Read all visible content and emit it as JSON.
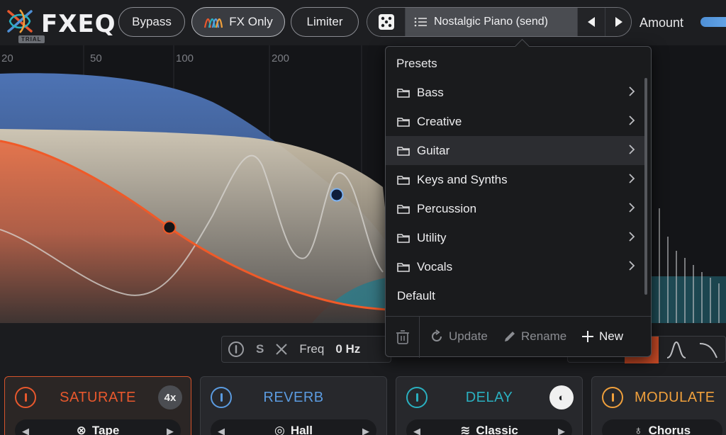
{
  "app": {
    "name": "FXEQ",
    "badge": "TRIAL"
  },
  "toolbar": {
    "bypass_label": "Bypass",
    "fx_only_label": "FX Only",
    "limiter_label": "Limiter",
    "preset_name": "Nostalgic Piano (send)",
    "amount_label": "Amount"
  },
  "eq": {
    "freq_labels": [
      "20",
      "50",
      "100",
      "200"
    ]
  },
  "band_controls": {
    "solo": "S",
    "freq_label": "Freq",
    "freq_value": "0 Hz"
  },
  "presets": {
    "header": "Presets",
    "folders": [
      "Bass",
      "Creative",
      "Guitar",
      "Keys and Synths",
      "Percussion",
      "Utility",
      "Vocals"
    ],
    "highlighted": "Guitar",
    "default_item": "Default",
    "actions": {
      "update": "Update",
      "rename": "Rename",
      "new": "New"
    }
  },
  "modules": {
    "saturate": {
      "title": "SATURATE",
      "badge": "4x",
      "mode": "Tape",
      "color": "#e8582d"
    },
    "reverb": {
      "title": "REVERB",
      "mode": "Hall",
      "color": "#5b9be0"
    },
    "delay": {
      "title": "DELAY",
      "mode": "Classic",
      "color": "#2ab0c0"
    },
    "modulate": {
      "title": "MODULATE",
      "mode": "Chorus",
      "color": "#f0a03c"
    }
  },
  "colors": {
    "accent_orange": "#e8582d",
    "accent_blue": "#4e8fd6"
  },
  "icons": {
    "logo": "fxeq-logo-icon",
    "dice": "dice-icon",
    "list": "list-icon",
    "folder": "folder-icon",
    "trash": "trash-icon"
  }
}
